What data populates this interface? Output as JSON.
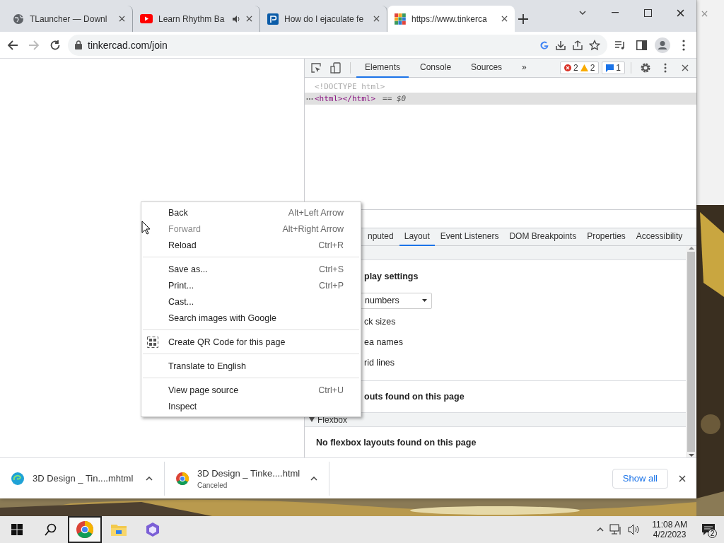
{
  "tabs": [
    {
      "title": "TLauncher — Downl",
      "audio": false,
      "selected": false
    },
    {
      "title": "Learn Rhythm Ba",
      "audio": true,
      "selected": false
    },
    {
      "title": "How do I ejaculate fe",
      "audio": false,
      "selected": false
    },
    {
      "title": "https://www.tinkerca",
      "audio": false,
      "selected": true
    }
  ],
  "address": {
    "url": "tinkercad.com/join"
  },
  "devtools": {
    "tabs": [
      {
        "label": "Elements",
        "selected": true
      },
      {
        "label": "Console",
        "selected": false
      },
      {
        "label": "Sources",
        "selected": false
      }
    ],
    "more": "»",
    "errors": "2",
    "warnings": "2",
    "messages": "1",
    "dom": [
      {
        "text": "<!DOCTYPE html>",
        "kind": "doctype",
        "selected": false
      },
      {
        "text": "<html></html>",
        "kind": "element",
        "selected": true,
        "suffix": "== *$0*"
      }
    ],
    "pane_tabs": [
      {
        "label": "nputed",
        "selected": false
      },
      {
        "label": "Layout",
        "selected": true
      },
      {
        "label": "Event Listeners",
        "selected": false
      },
      {
        "label": "DOM Breakpoints",
        "selected": false
      },
      {
        "label": "Properties",
        "selected": false
      },
      {
        "label": "Accessibility",
        "selected": false
      }
    ],
    "layout": {
      "heading": "play settings",
      "select_value": "numbers",
      "options": [
        "ck sizes",
        "ea names",
        "rid lines"
      ],
      "grid_empty": "outs found on this page",
      "flexbox": {
        "title": "Flexbox",
        "expanded": true,
        "empty": "No flexbox layouts found on this page"
      }
    }
  },
  "context_menu": [
    {
      "kind": "item",
      "label": "Back",
      "shortcut": "Alt+Left Arrow",
      "disabled": false
    },
    {
      "kind": "item",
      "label": "Forward",
      "shortcut": "Alt+Right Arrow",
      "disabled": true
    },
    {
      "kind": "item",
      "label": "Reload",
      "shortcut": "Ctrl+R",
      "disabled": false
    },
    {
      "kind": "separator"
    },
    {
      "kind": "item",
      "label": "Save as...",
      "shortcut": "Ctrl+S",
      "disabled": false
    },
    {
      "kind": "item",
      "label": "Print...",
      "shortcut": "Ctrl+P",
      "disabled": false
    },
    {
      "kind": "item",
      "label": "Cast...",
      "disabled": false
    },
    {
      "kind": "item",
      "label": "Search images with Google",
      "disabled": false
    },
    {
      "kind": "separator"
    },
    {
      "kind": "qr",
      "label": "Create QR Code for this page",
      "disabled": false
    },
    {
      "kind": "separator"
    },
    {
      "kind": "item",
      "label": "Translate to English",
      "disabled": false
    },
    {
      "kind": "separator"
    },
    {
      "kind": "item",
      "label": "View page source",
      "shortcut": "Ctrl+U",
      "disabled": false
    },
    {
      "kind": "item",
      "label": "Inspect",
      "disabled": false
    }
  ],
  "downloads": {
    "items": [
      {
        "name": "3D Design _ Tin....mhtml"
      },
      {
        "name": "3D Design _ Tinke....html",
        "status": "Canceled"
      }
    ],
    "show_all": "Show all"
  },
  "taskbar": {
    "apps": [
      {
        "active": true
      },
      {
        "active": false
      },
      {
        "active": false
      }
    ],
    "time": "11:08 AM",
    "date": "4/2/2023",
    "notifications": "2"
  }
}
